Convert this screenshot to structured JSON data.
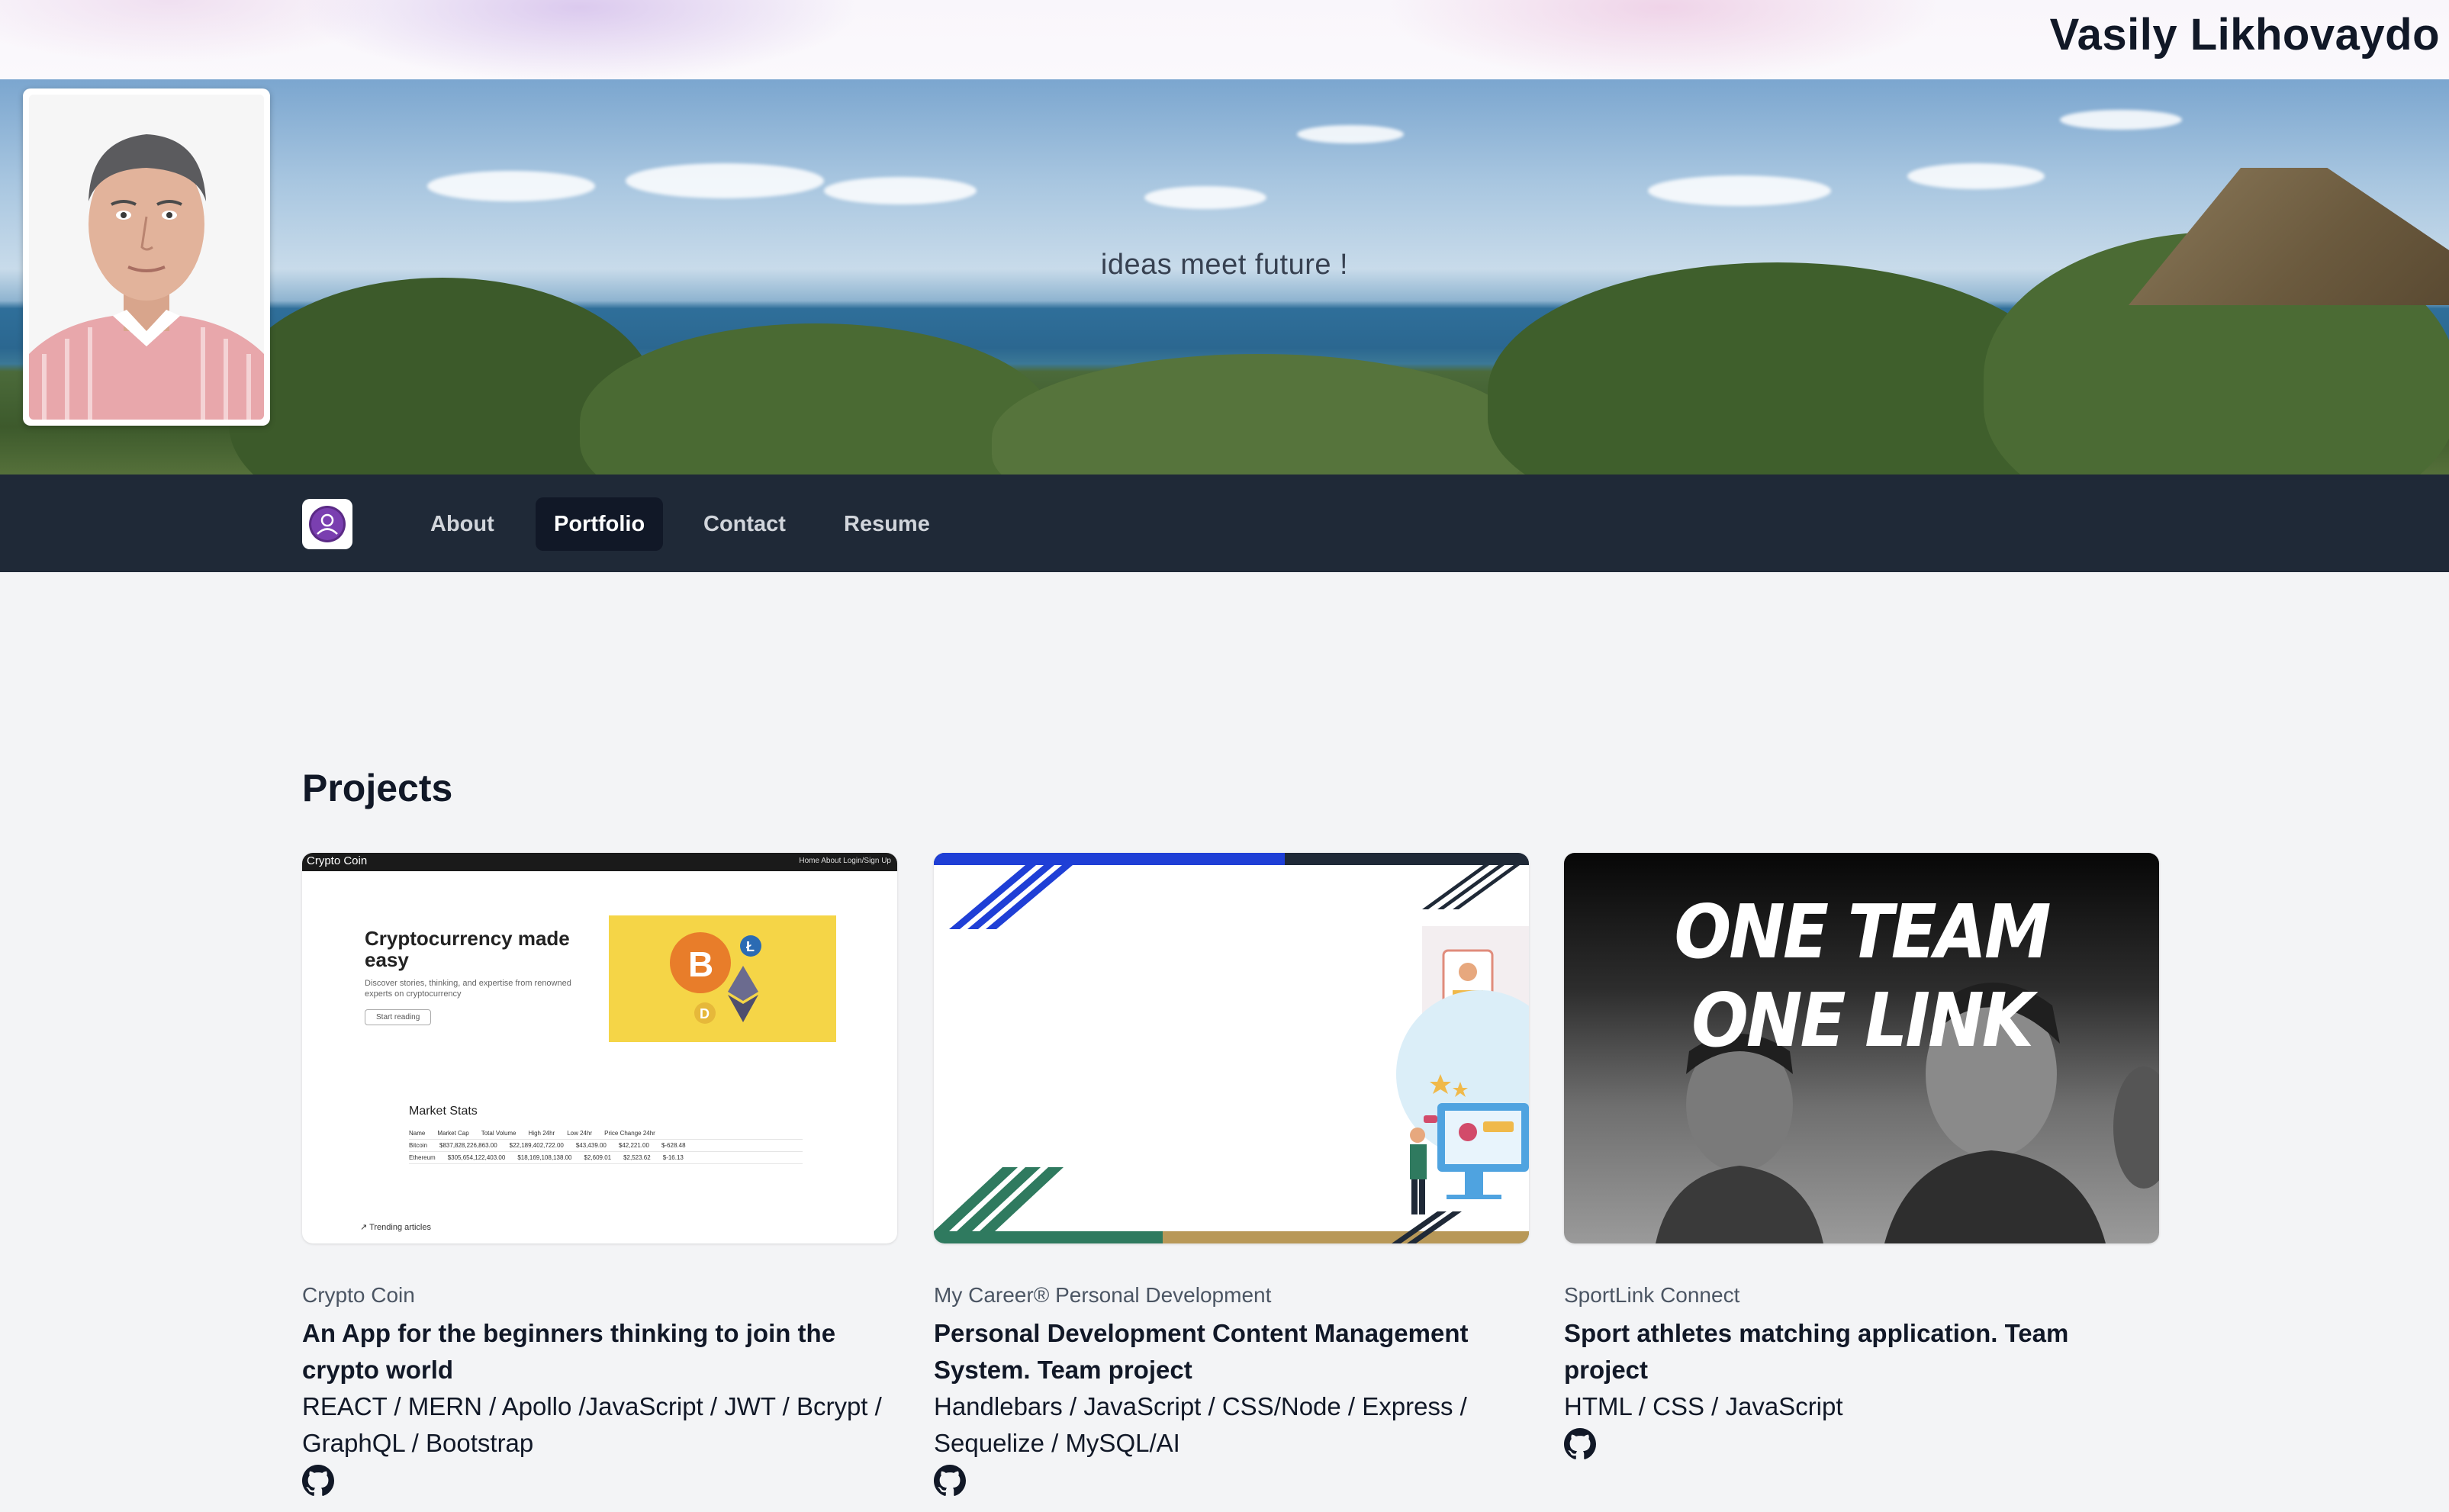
{
  "header": {
    "site_name": "Vasily Likhovaydo",
    "tagline": "ideas meet future !",
    "avatar_alt": "Profile photo"
  },
  "nav": {
    "logo_icon": "user-circle-icon",
    "items": [
      {
        "label": "About",
        "active": false
      },
      {
        "label": "Portfolio",
        "active": true
      },
      {
        "label": "Contact",
        "active": false
      },
      {
        "label": "Resume",
        "active": false
      }
    ]
  },
  "projects": {
    "title": "Projects",
    "items": [
      {
        "category": "Crypto Coin",
        "title": "An App for the beginners thinking to join the crypto world",
        "stack": "REACT / MERN / Apollo /JavaScript / JWT / Bcrypt / GraphQL / Bootstrap",
        "github_icon": "github-icon",
        "preview": {
          "brand": "Crypto Coin",
          "nav_links": "Home   About   Login/Sign Up",
          "headline": "Cryptocurrency made easy",
          "subtext": "Discover stories, thinking, and expertise from renowned experts on cryptocurrency",
          "button": "Start reading",
          "market_title": "Market Stats",
          "table_header": [
            "Name",
            "Market Cap",
            "Total Volume",
            "High 24hr",
            "Low 24hr",
            "Price Change 24hr"
          ],
          "table_rows": [
            [
              "Bitcoin",
              "$837,828,226,863.00",
              "$22,189,402,722.00",
              "$43,439.00",
              "$42,221.00",
              "$-628.48"
            ],
            [
              "Ethereum",
              "$305,654,122,403.00",
              "$18,169,108,138.00",
              "$2,609.01",
              "$2,523.62",
              "$-16.13"
            ]
          ],
          "trending": "Trending articles"
        }
      },
      {
        "category": "My Career® Personal Development",
        "title": "Personal Development Content Management System. Team project",
        "stack": "Handlebars / JavaScript / CSS/Node / Express / Sequelize / MySQL/AI",
        "github_icon": "github-icon"
      },
      {
        "category": "SportLink Connect",
        "title": "Sport athletes matching application. Team project",
        "stack": "HTML / CSS / JavaScript",
        "github_icon": "github-icon",
        "preview": {
          "line1": "ONE TEAM",
          "line2": "ONE LINK"
        }
      }
    ]
  },
  "colors": {
    "nav_bg": "#1f2937",
    "nav_active_bg": "#111827",
    "page_bg": "#f3f4f6",
    "crypto_yellow": "#f5d547",
    "career_blue": "#1f3fd6",
    "career_green": "#2f7a5f"
  }
}
